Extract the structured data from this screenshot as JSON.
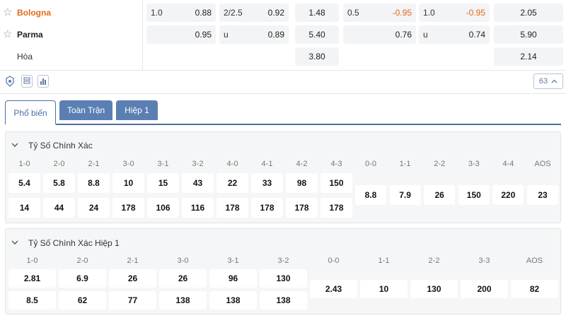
{
  "teams": [
    {
      "name": "Bologna",
      "odds": [
        "1.0",
        "0.88",
        "2/2.5",
        "0.92",
        "1.48",
        "0.5",
        "-0.95",
        "1.0",
        "-0.95",
        "2.05"
      ]
    },
    {
      "name": "Parma",
      "odds": [
        "",
        "0.95",
        "u",
        "0.89",
        "5.40",
        "",
        "0.76",
        "u",
        "0.74",
        "5.90"
      ]
    },
    {
      "name": "Hòa",
      "odds": [
        "",
        "",
        "",
        "",
        "3.80",
        "",
        "",
        "",
        "",
        "2.14"
      ]
    }
  ],
  "toolbar": {
    "count": "63"
  },
  "tabs": [
    "Phổ biến",
    "Toàn Trận",
    "Hiệp 1"
  ],
  "full_time": {
    "title": "Tỷ Số Chính Xác",
    "home_win": {
      "scores": [
        "1-0",
        "2-0",
        "2-1",
        "3-0",
        "3-1",
        "3-2",
        "4-0",
        "4-1",
        "4-2",
        "4-3"
      ],
      "row1": [
        "5.4",
        "5.8",
        "8.8",
        "10",
        "15",
        "43",
        "22",
        "33",
        "98",
        "150"
      ],
      "row2": [
        "14",
        "44",
        "24",
        "178",
        "106",
        "116",
        "178",
        "178",
        "178",
        "178"
      ]
    },
    "draw_other": {
      "scores": [
        "0-0",
        "1-1",
        "2-2",
        "3-3",
        "4-4",
        "AOS"
      ],
      "values": [
        "8.8",
        "7.9",
        "26",
        "150",
        "220",
        "23"
      ]
    }
  },
  "first_half": {
    "title": "Tỷ Số Chính Xác Hiệp 1",
    "home_win": {
      "scores": [
        "1-0",
        "2-0",
        "2-1",
        "3-0",
        "3-1",
        "3-2"
      ],
      "row1": [
        "2.81",
        "6.9",
        "26",
        "26",
        "96",
        "130"
      ],
      "row2": [
        "8.5",
        "62",
        "77",
        "138",
        "138",
        "138"
      ]
    },
    "draw_other": {
      "scores": [
        "0-0",
        "1-1",
        "2-2",
        "3-3",
        "AOS"
      ],
      "values": [
        "2.43",
        "10",
        "130",
        "200",
        "82"
      ]
    }
  }
}
